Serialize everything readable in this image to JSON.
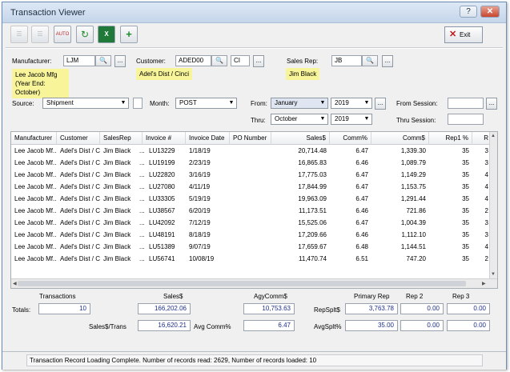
{
  "window": {
    "title": "Transaction Viewer",
    "help_label": "?",
    "close_label": "✕"
  },
  "toolbar": {
    "auto_label": "AUTO",
    "exit_label": "Exit"
  },
  "manufacturer": {
    "label": "Manufacturer:",
    "code": "LJM",
    "name": "Lee Jacob Mfg",
    "year_end": "(Year End: October)"
  },
  "customer": {
    "label": "Customer:",
    "code": "ADED00",
    "suffix": "CI",
    "name": "Adel's Dist / Cinci"
  },
  "sales_rep": {
    "label": "Sales Rep:",
    "code": "JB",
    "name": "Jim Black"
  },
  "filters": {
    "source_label": "Source:",
    "source_value": "Shipment",
    "month_label": "Month:",
    "month_value": "POST",
    "from_label": "From:",
    "from_month": "January",
    "from_year": "2019",
    "thru_label": "Thru:",
    "thru_month": "October",
    "thru_year": "2019",
    "from_session_label": "From Session:",
    "thru_session_label": "Thru Session:"
  },
  "grid": {
    "columns": [
      "Manufacturer",
      "Customer",
      "SalesRep",
      "Invoice #",
      "Invoice Date",
      "PO Number",
      "Sales$",
      "Comm%",
      "Comm$",
      "Rep1 %",
      "R"
    ],
    "rows": [
      [
        "Lee Jacob Mf...",
        "Adel's Dist / C...",
        "Jim Black",
        "...",
        "LU13229",
        "1/18/19",
        "",
        "20,714.48",
        "6.47",
        "1,339.30",
        "35",
        "3"
      ],
      [
        "Lee Jacob Mf...",
        "Adel's Dist / C...",
        "Jim Black",
        "...",
        "LU19199",
        "2/23/19",
        "",
        "16,865.83",
        "6.46",
        "1,089.79",
        "35",
        "3"
      ],
      [
        "Lee Jacob Mf...",
        "Adel's Dist / C...",
        "Jim Black",
        "...",
        "LU22820",
        "3/16/19",
        "",
        "17,775.03",
        "6.47",
        "1,149.29",
        "35",
        "4"
      ],
      [
        "Lee Jacob Mf...",
        "Adel's Dist / C...",
        "Jim Black",
        "...",
        "LU27080",
        "4/11/19",
        "",
        "17,844.99",
        "6.47",
        "1,153.75",
        "35",
        "4"
      ],
      [
        "Lee Jacob Mf...",
        "Adel's Dist / C...",
        "Jim Black",
        "...",
        "LU33305",
        "5/19/19",
        "",
        "19,963.09",
        "6.47",
        "1,291.44",
        "35",
        "4"
      ],
      [
        "Lee Jacob Mf...",
        "Adel's Dist / C...",
        "Jim Black",
        "...",
        "LU38567",
        "6/20/19",
        "",
        "11,173.51",
        "6.46",
        "721.86",
        "35",
        "2"
      ],
      [
        "Lee Jacob Mf...",
        "Adel's Dist / C...",
        "Jim Black",
        "...",
        "LU42092",
        "7/12/19",
        "",
        "15,525.06",
        "6.47",
        "1,004.39",
        "35",
        "3"
      ],
      [
        "Lee Jacob Mf...",
        "Adel's Dist / C...",
        "Jim Black",
        "...",
        "LU48191",
        "8/18/19",
        "",
        "17,209.66",
        "6.46",
        "1,112.10",
        "35",
        "3"
      ],
      [
        "Lee Jacob Mf...",
        "Adel's Dist / C...",
        "Jim Black",
        "...",
        "LU51389",
        "9/07/19",
        "",
        "17,659.67",
        "6.48",
        "1,144.51",
        "35",
        "4"
      ],
      [
        "Lee Jacob Mf...",
        "Adel's Dist / C...",
        "Jim Black",
        "...",
        "LU56741",
        "10/08/19",
        "",
        "11,470.74",
        "6.51",
        "747.20",
        "35",
        "2"
      ]
    ]
  },
  "totals": {
    "transactions_header": "Transactions",
    "sales_header": "Sales$",
    "agycomm_header": "AgyComm$",
    "primary_rep_header": "Primary Rep",
    "rep2_header": "Rep 2",
    "rep3_header": "Rep 3",
    "totals_label": "Totals:",
    "transactions": "10",
    "sales": "166,202.06",
    "agycomm": "10,753.63",
    "repsplit_label": "RepSplt$",
    "primary_rep": "3,763.78",
    "rep2": "0.00",
    "rep3": "0.00",
    "sales_per_trans_label": "Sales$/Trans",
    "sales_per_trans": "16,620.21",
    "avg_comm_label": "Avg Comm%",
    "avg_comm": "6.47",
    "avgsplit_label": "AvgSplt%",
    "avg_primary": "35.00",
    "avg_rep2": "0.00",
    "avg_rep3": "0.00"
  },
  "status": {
    "message": "Transaction Record Loading Complete.   Number of records read: 2629,    Number of records loaded: 10"
  }
}
